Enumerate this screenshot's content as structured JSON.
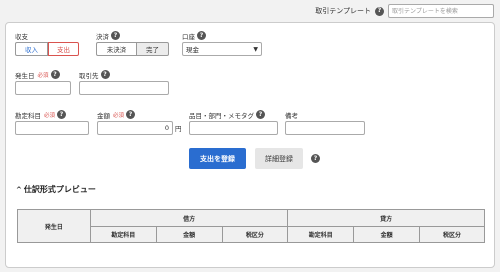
{
  "header": {
    "template_label": "取引テンプレート",
    "template_search_placeholder": "取引テンプレートを検索"
  },
  "form": {
    "income_expense": {
      "label": "収支",
      "options": [
        "収入",
        "支出"
      ],
      "selected": "支出"
    },
    "settlement": {
      "label": "決済",
      "options": [
        "未決済",
        "完了"
      ],
      "selected": "完了"
    },
    "account": {
      "label": "口座",
      "value": "現金"
    },
    "date": {
      "label": "発生日",
      "required": "必須",
      "value": ""
    },
    "partner": {
      "label": "取引先",
      "value": ""
    },
    "account_item": {
      "label": "勘定科目",
      "required": "必須",
      "value": ""
    },
    "amount": {
      "label": "金額",
      "required": "必須",
      "value": "0",
      "unit": "円"
    },
    "item_tags": {
      "label": "品目・部門・メモタグ",
      "value": ""
    },
    "remarks": {
      "label": "備考",
      "value": ""
    }
  },
  "actions": {
    "register_expense": "支出を登録",
    "detail_register": "詳細登録"
  },
  "preview": {
    "title": "仕訳形式プレビュー",
    "date_header": "発生日",
    "debit_header": "借方",
    "credit_header": "貸方",
    "sub_headers": [
      "勘定科目",
      "金額",
      "税区分"
    ]
  },
  "colors": {
    "primary": "#2a6dd0",
    "required": "#d9534f",
    "selected_expense": "#d9534f"
  }
}
